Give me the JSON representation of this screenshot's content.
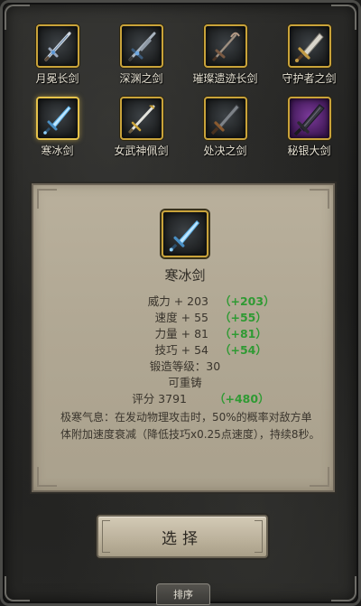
{
  "weapons": [
    {
      "name": "月冕长剑",
      "icon": "ornate-longsword-icon"
    },
    {
      "name": "深渊之剑",
      "icon": "abyss-sword-icon"
    },
    {
      "name": "璀璨遗迹长剑",
      "icon": "relic-longsword-icon"
    },
    {
      "name": "守护者之剑",
      "icon": "guardian-sword-icon"
    },
    {
      "name": "寒冰剑",
      "icon": "ice-sword-icon"
    },
    {
      "name": "女武神佩剑",
      "icon": "valkyrie-sword-icon"
    },
    {
      "name": "处决之剑",
      "icon": "execution-sword-icon"
    },
    {
      "name": "秘银大剑",
      "icon": "mithril-greatsword-icon"
    }
  ],
  "selected_index": 4,
  "detail": {
    "title": "寒冰剑",
    "stats": [
      {
        "base": "威力 + 203",
        "bonus": "（+203）"
      },
      {
        "base": "速度 + 55",
        "bonus": "（+55）"
      },
      {
        "base": "力量 + 81",
        "bonus": "（+81）"
      },
      {
        "base": "技巧 + 54",
        "bonus": "（+54）"
      }
    ],
    "forge_level": "锻造等级：30",
    "reforgeable": "可重铸",
    "score": {
      "base": "评分 3791",
      "bonus": "（+480）"
    },
    "description": "极寒气息：在发动物理攻击时，50%的概率对敌方单体附加速度衰减（降低技巧x0.25点速度），持续8秒。"
  },
  "buttons": {
    "select": "选择",
    "sort": "排序"
  },
  "colors": {
    "slot_border": "#c9a33a",
    "bonus_green": "#2f9a33",
    "panel_bg": "#b0a793",
    "rare_purple": "#7b3a9a"
  }
}
